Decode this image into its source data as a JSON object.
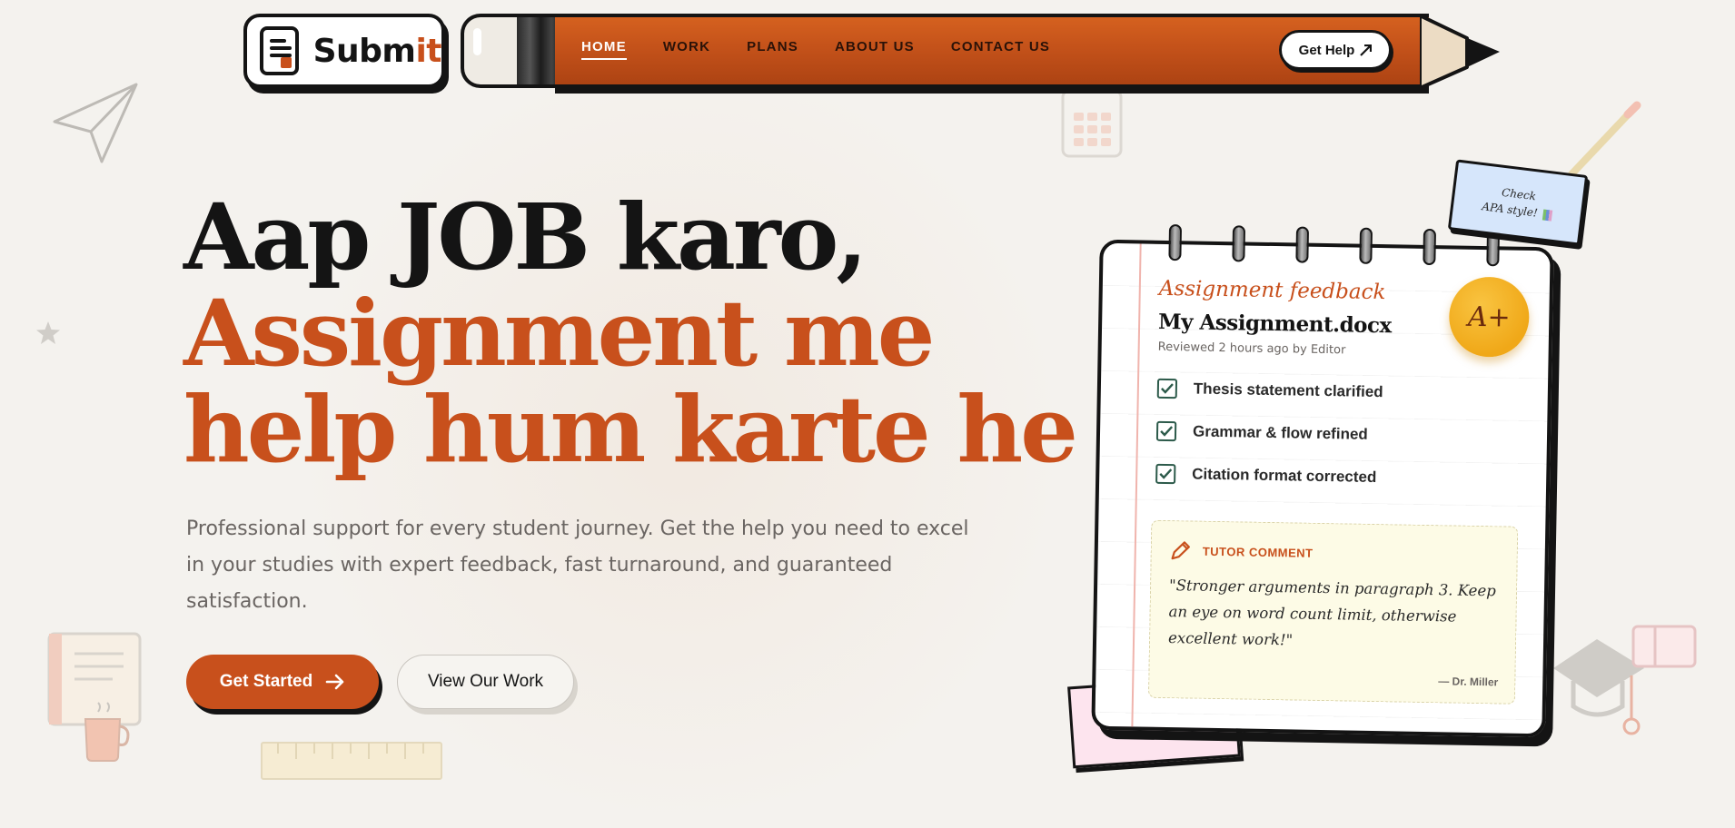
{
  "brand": {
    "name_main": "Subm",
    "name_accent": "it"
  },
  "nav": {
    "links": [
      "HOME",
      "WORK",
      "PLANS",
      "ABOUT US",
      "CONTACT US"
    ],
    "active_index": 0,
    "cta_label": "Get Help"
  },
  "hero": {
    "title_line1": "Aap JOB karo,",
    "title_line2": "Assignment me",
    "title_line3": "help hum karte he",
    "description": "Professional support for every student journey. Get the help you need to excel in your studies with expert feedback, fast turnaround, and guaranteed satisfaction.",
    "primary_cta": "Get Started",
    "secondary_cta": "View Our Work"
  },
  "feedback_card": {
    "kicker": "Assignment feedback",
    "file_name": "My Assignment.docx",
    "meta": "Reviewed 2 hours ago by Editor",
    "grade": "A+",
    "checklist": [
      "Thesis statement clarified",
      "Grammar & flow refined",
      "Citation format corrected"
    ],
    "tutor_label": "TUTOR COMMENT",
    "tutor_quote": "\"Stronger arguments in paragraph 3. Keep an eye on word count limit, otherwise excellent work!\"",
    "tutor_author": "— Dr. Miller"
  },
  "sticky_note": {
    "line1": "Check",
    "line2": "APA style!"
  },
  "colors": {
    "accent": "#c8501c",
    "ink": "#141414",
    "background": "#f4f2ee",
    "grade": "#f0a818"
  }
}
